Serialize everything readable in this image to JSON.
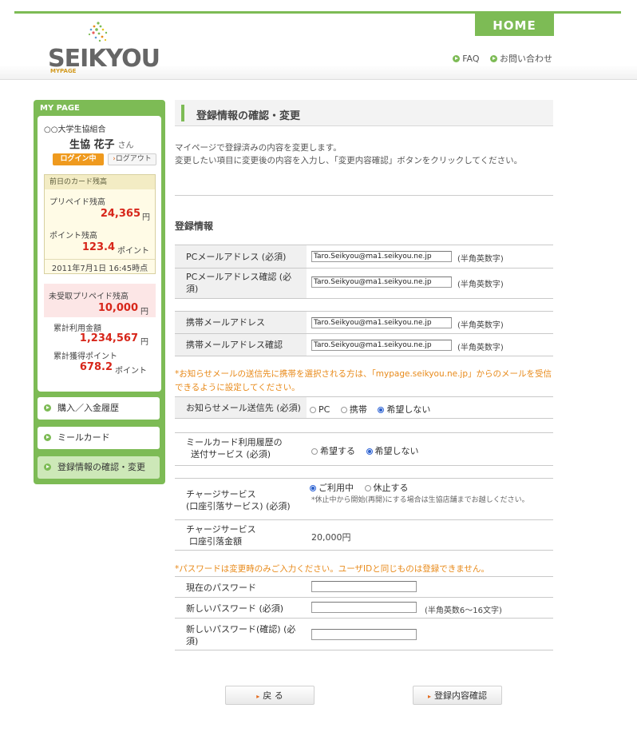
{
  "header": {
    "home_label": "HOME",
    "logo_text": "SEIKYOU",
    "logo_sub": "MYPAGE",
    "faq_label": "FAQ",
    "contact_label": "お問い合わせ"
  },
  "sidebar": {
    "title": "MY PAGE",
    "coop_name": "○○大学生協組合",
    "user_name": "生協 花子",
    "honorific": "さん",
    "login_status": "ログイン中",
    "logout_label": "ログアウト",
    "card_header": "前日のカード残高",
    "prepaid_label": "プリペイド残高",
    "prepaid_value": "24,365",
    "prepaid_unit": "円",
    "point_label": "ポイント残高",
    "point_value": "123.4",
    "point_unit": "ポイント",
    "card_date": "2011年7月1日 16:45時点",
    "unreceived_label": "未受取プリペイド残高",
    "unreceived_value": "10,000",
    "unreceived_unit": "円",
    "total_used_label": "累計利用金額",
    "total_used_value": "1,234,567",
    "total_used_unit": "円",
    "total_points_label": "累計獲得ポイント",
    "total_points_value": "678.2",
    "total_points_unit": "ポイント",
    "nav": [
      {
        "label": "購入／入金履歴"
      },
      {
        "label": "ミールカード"
      },
      {
        "label": "登録情報の確認・変更"
      }
    ]
  },
  "main": {
    "page_title": "登録情報の確認・変更",
    "intro_line1": "マイページで登録済みの内容を変更します。",
    "intro_line2": "変更したい項目に変更後の内容を入力し、「変更内容確認」ボタンをクリックしてください。",
    "section_title": "登録情報",
    "pc_mail_label": "PCメールアドレス (必須)",
    "pc_mail_value": "Taro.Seikyou@ma1.seikyou.ne.jp",
    "pc_mail_hint": "(半角英数字)",
    "pc_mail_confirm_label": "PCメールアドレス確認 (必須)",
    "pc_mail_confirm_value": "Taro.Seikyou@ma1.seikyou.ne.jp",
    "pc_mail_confirm_hint": "(半角英数字)",
    "mobile_mail_label": "携帯メールアドレス",
    "mobile_mail_value": "Taro.Seikyou@ma1.seikyou.ne.jp",
    "mobile_mail_hint": "(半角英数字)",
    "mobile_mail_confirm_label": "携帯メールアドレス確認",
    "mobile_mail_confirm_value": "Taro.Seikyou@ma1.seikyou.ne.jp",
    "mobile_mail_confirm_hint": "(半角英数字)",
    "notice_mobile": "*お知らせメールの送信先に携帯を選択される方は、「mypage.seikyou.ne.jp」からのメールを受信できるように設定してください。",
    "notify_label": "お知らせメール送信先 (必須)",
    "notify_options": [
      "PC",
      "携帯",
      "希望しない"
    ],
    "notify_selected": "希望しない",
    "meal_label_1": "ミールカード利用履歴の",
    "meal_label_2": "送付サービス (必須)",
    "meal_options": [
      "希望する",
      "希望しない"
    ],
    "meal_selected": "希望しない",
    "charge_label_1": "チャージサービス",
    "charge_label_2": "(口座引落サービス) (必須)",
    "charge_options": [
      "ご利用中",
      "休止する"
    ],
    "charge_selected": "ご利用中",
    "charge_note": "*休止中から開始(再開)にする場合は生協店舗までお越しください。",
    "charge_amount_label_1": "チャージサービス",
    "charge_amount_label_2": "口座引落金額",
    "charge_amount_value": "20,000円",
    "notice_password": "*パスワードは変更時のみご入力ください。ユーザIDと同じものは登録できません。",
    "current_pw_label": "現在のパスワード",
    "new_pw_label": "新しいパスワード (必須)",
    "new_pw_hint": "(半角英数6～16文字)",
    "new_pw_confirm_label": "新しいパスワード(確認) (必須)",
    "back_label": "戻 る",
    "confirm_label": "登録内容確認"
  }
}
